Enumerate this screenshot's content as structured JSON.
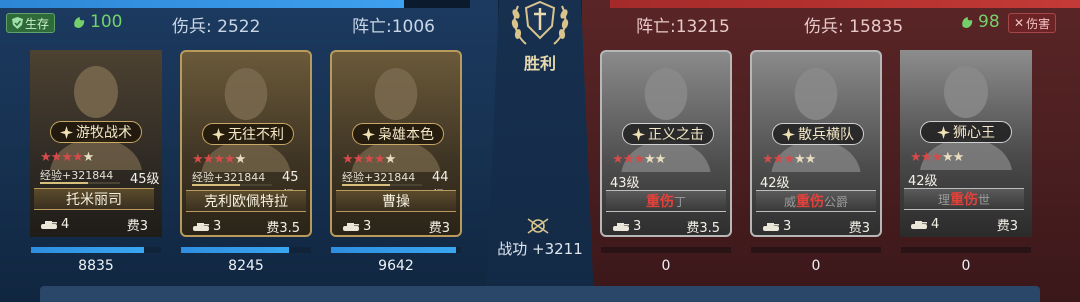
{
  "left": {
    "status_badge": "生存",
    "morale": "100",
    "wounded_label": "伤兵: 2522",
    "dead_label": "阵亡:1006",
    "progress": 0.86
  },
  "right": {
    "dead_label": "阵亡:13215",
    "wounded_label": "伤兵: 15835",
    "morale": "98",
    "status_badge": "伤害",
    "progress": 1.0
  },
  "center": {
    "result": "胜利",
    "merit": "战功 +3211"
  },
  "left_heroes": [
    {
      "skill": "游牧战术",
      "stars": 4,
      "exp": "经验+321844",
      "level": "45级",
      "name": "托米丽司",
      "troops": "4",
      "cost": "费3",
      "hp": "8835",
      "hp_fill": 0.87
    },
    {
      "skill": "无往不利",
      "stars": 4,
      "exp": "经验+321844",
      "level": "45级",
      "name": "克利欧佩特拉",
      "troops": "3",
      "cost": "费3.5",
      "hp": "8245",
      "hp_fill": 0.83
    },
    {
      "skill": "枭雄本色",
      "stars": 4,
      "exp": "经验+321844",
      "level": "44级",
      "name": "曹操",
      "troops": "3",
      "cost": "费3",
      "hp": "9642",
      "hp_fill": 0.96
    }
  ],
  "right_heroes": [
    {
      "skill": "正义之击",
      "stars": 3,
      "level": "43级",
      "name": "重伤",
      "name_ghost_suffix": "丁",
      "troops": "3",
      "cost": "费3.5",
      "hp": "0"
    },
    {
      "skill": "散兵横队",
      "stars": 3,
      "level": "42级",
      "name_ghost_prefix": "威",
      "name": "重伤",
      "name_ghost_suffix": "公爵",
      "troops": "3",
      "cost": "费3",
      "hp": "0"
    },
    {
      "skill": "狮心王",
      "stars": 3,
      "level": "42级",
      "name_ghost_prefix": "理",
      "name": "重伤",
      "name_ghost_suffix": "世",
      "troops": "4",
      "cost": "费3",
      "hp": "0"
    }
  ]
}
